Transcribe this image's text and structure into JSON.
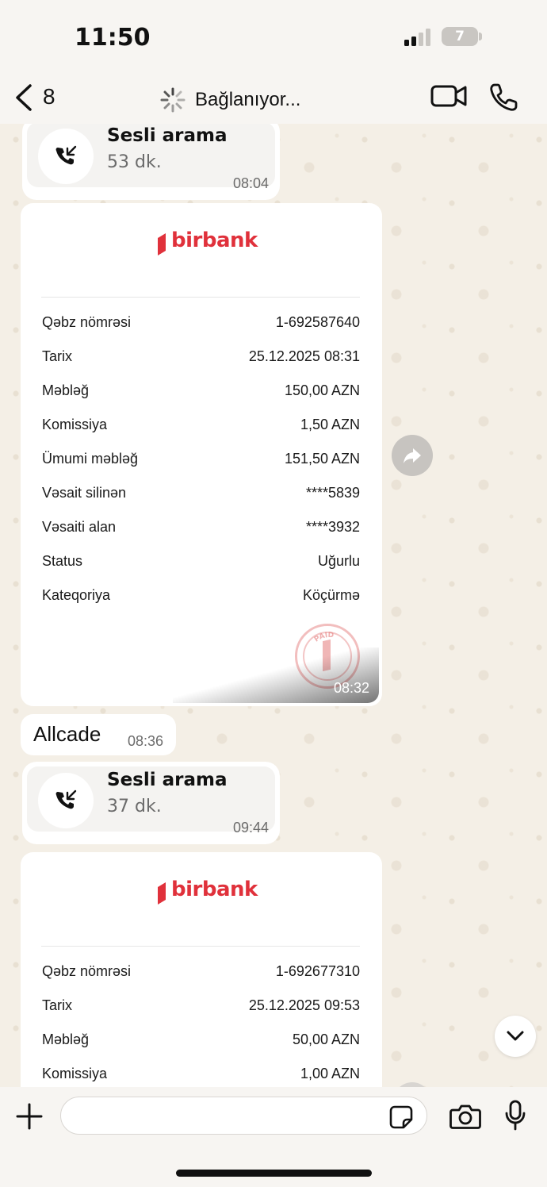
{
  "status_bar": {
    "time": "11:50",
    "battery": "7"
  },
  "nav": {
    "back_count": "8",
    "title": "Bağlanıyor..."
  },
  "messages": {
    "call1": {
      "title": "Sesli arama",
      "duration": "53 dk.",
      "time": "08:04"
    },
    "receipt1": {
      "brand": "birbank",
      "rows": [
        {
          "label": "Qəbz nömrəsi",
          "value": "1-692587640"
        },
        {
          "label": "Tarix",
          "value": "25.12.2025 08:31"
        },
        {
          "label": "Məbləğ",
          "value": "150,00 AZN"
        },
        {
          "label": "Komissiya",
          "value": "1,50 AZN"
        },
        {
          "label": "Ümumi məbləğ",
          "value": "151,50 AZN"
        },
        {
          "label": "Vəsait silinən",
          "value": "****5839"
        },
        {
          "label": "Vəsaiti alan",
          "value": "****3932"
        },
        {
          "label": "Status",
          "value": "Uğurlu"
        },
        {
          "label": "Kateqoriya",
          "value": "Köçürmə"
        }
      ],
      "stamp_text": "PAID",
      "time": "08:32"
    },
    "text1": {
      "text": "Allcade",
      "time": "08:36"
    },
    "call2": {
      "title": "Sesli arama",
      "duration": "37 dk.",
      "time": "09:44"
    },
    "receipt2": {
      "brand": "birbank",
      "rows": [
        {
          "label": "Qəbz nömrəsi",
          "value": "1-692677310"
        },
        {
          "label": "Tarix",
          "value": "25.12.2025 09:53"
        },
        {
          "label": "Məbləğ",
          "value": "50,00 AZN"
        },
        {
          "label": "Komissiya",
          "value": "1,00 AZN"
        }
      ]
    }
  },
  "composer": {
    "value": "",
    "placeholder": ""
  },
  "colors": {
    "brand_red": "#e0313b",
    "chat_bg": "#f4efe6",
    "bubble": "#ffffff"
  }
}
